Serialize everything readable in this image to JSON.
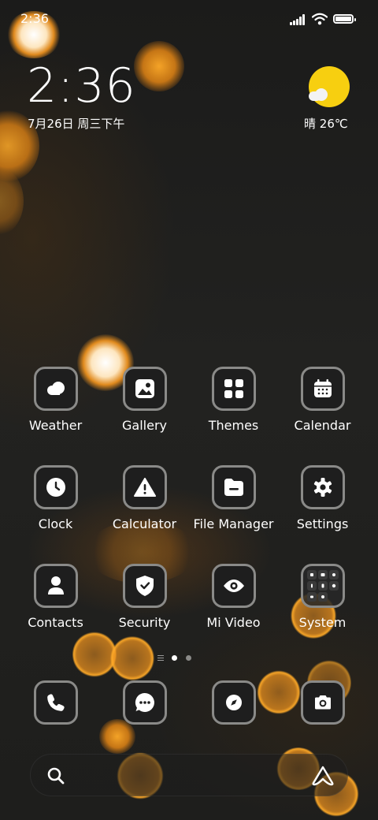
{
  "status_bar": {
    "time": "2:36"
  },
  "clock_widget": {
    "time": "2:36",
    "date": "7月26日 周三下午"
  },
  "weather_widget": {
    "condition": "晴",
    "temperature": "26℃",
    "icon": "sunny-cloud-icon"
  },
  "apps": [
    {
      "label": "Weather",
      "icon": "weather-icon"
    },
    {
      "label": "Gallery",
      "icon": "gallery-icon"
    },
    {
      "label": "Themes",
      "icon": "themes-icon"
    },
    {
      "label": "Calendar",
      "icon": "calendar-icon"
    },
    {
      "label": "Clock",
      "icon": "clock-icon"
    },
    {
      "label": "Calculator",
      "icon": "calculator-icon"
    },
    {
      "label": "File Manager",
      "icon": "file-manager-icon"
    },
    {
      "label": "Settings",
      "icon": "settings-icon"
    },
    {
      "label": "Contacts",
      "icon": "contacts-icon"
    },
    {
      "label": "Security",
      "icon": "security-icon"
    },
    {
      "label": "Mi Video",
      "icon": "mi-video-icon"
    },
    {
      "label": "System",
      "icon": "system-folder-icon"
    }
  ],
  "page_indicator": {
    "pages": 2,
    "current": 1
  },
  "dock": [
    {
      "icon": "phone-icon"
    },
    {
      "icon": "messages-icon"
    },
    {
      "icon": "browser-icon"
    },
    {
      "icon": "camera-icon"
    }
  ],
  "search_bar": {
    "icon": "search-icon",
    "assistant_icon": "assistant-icon"
  },
  "colors": {
    "tile_border": "#8a8a88",
    "tile_fill": "#1e1e1e",
    "sun": "#f7cf10",
    "bokeh": "#f5a020"
  }
}
